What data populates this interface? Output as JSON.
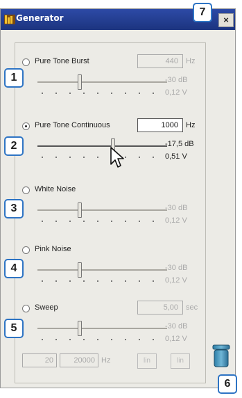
{
  "window": {
    "title": "Generator"
  },
  "close_label": "×",
  "rows": [
    {
      "label": "Pure Tone Burst",
      "freq": "440",
      "unit": "Hz",
      "db": "-30 dB",
      "volts": "0,12 V",
      "selected": false,
      "active": false
    },
    {
      "label": "Pure Tone Continuous",
      "freq": "1000",
      "unit": "Hz",
      "db": "-17,5 dB",
      "volts": "0,51 V",
      "selected": true,
      "active": true
    },
    {
      "label": "White Noise",
      "db": "-30 dB",
      "volts": "0,12 V",
      "selected": false,
      "active": false
    },
    {
      "label": "Pink Noise",
      "db": "-30 dB",
      "volts": "0,12 V",
      "selected": false,
      "active": false
    },
    {
      "label": "Sweep",
      "freq": "5,00",
      "unit": "sec",
      "db": "-30 dB",
      "volts": "0,12 V",
      "selected": false,
      "active": false
    }
  ],
  "sweep": {
    "from": "20",
    "to": "20000",
    "unit": "Hz",
    "btn1": "lin",
    "btn2": "lin"
  },
  "callouts": [
    "1",
    "2",
    "3",
    "4",
    "5",
    "6",
    "7"
  ],
  "icons": {
    "app": "app-icon",
    "close": "close-icon",
    "trash": "trash-icon",
    "cursor": "mouse-pointer-icon"
  }
}
